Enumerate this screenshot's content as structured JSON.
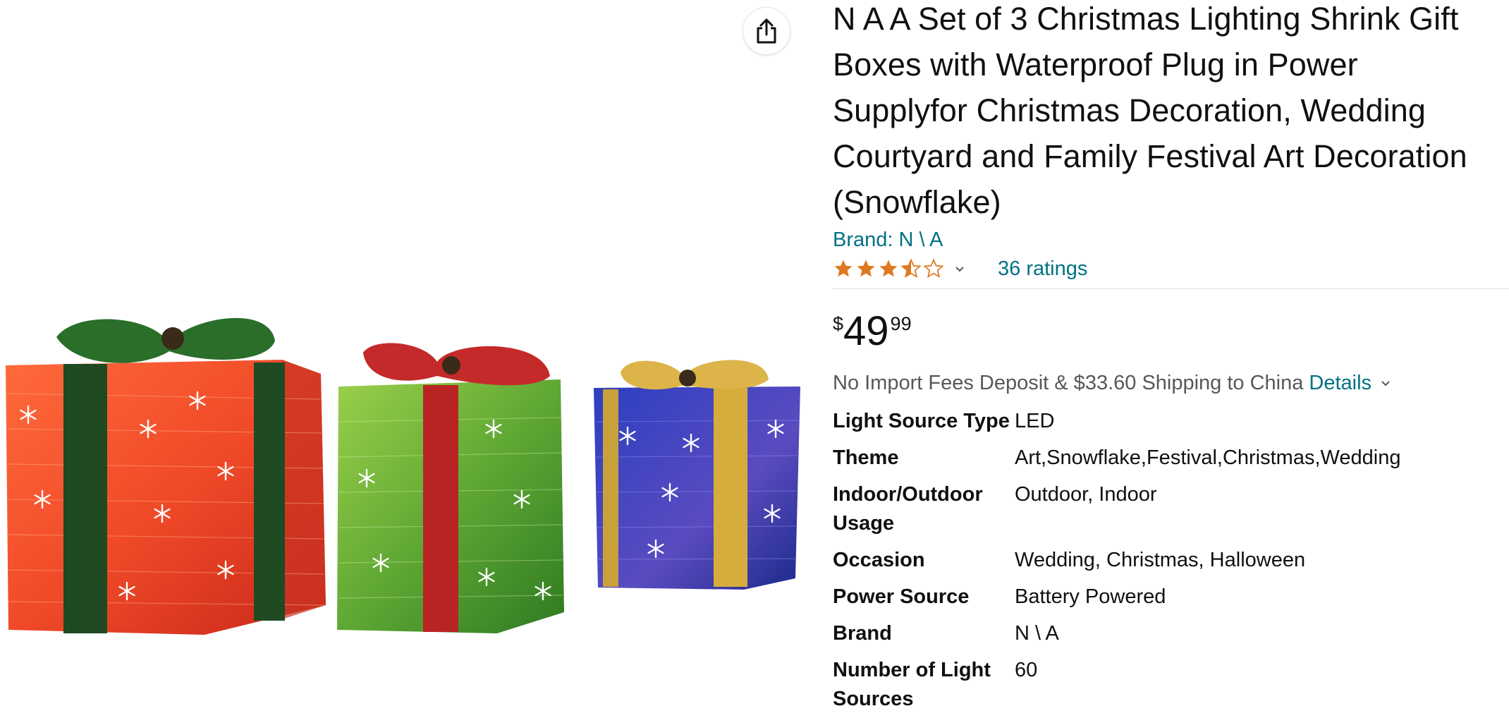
{
  "product": {
    "title": "N A A Set of 3 Christmas Lighting Shrink Gift Boxes with Waterproof Plug in Power Supplyfor Christmas Decoration, Wedding Courtyard and Family Festival Art Decoration (Snowflake)",
    "brand_link": "Brand: N \\ A",
    "rating": {
      "stars": 3.5,
      "out_of": 5,
      "ratings_label": "36 ratings"
    },
    "price": {
      "symbol": "$",
      "whole": "49",
      "fraction": "99"
    },
    "shipping": {
      "text": "No Import Fees Deposit & $33.60 Shipping to China",
      "details_label": "Details"
    },
    "specs": [
      {
        "label": "Light Source Type",
        "value": "LED"
      },
      {
        "label": "Theme",
        "value": "Art,Snowflake,Festival,Christmas,Wedding"
      },
      {
        "label": "Indoor/Outdoor Usage",
        "value": "Outdoor, Indoor"
      },
      {
        "label": "Occasion",
        "value": "Wedding, Christmas, Halloween"
      },
      {
        "label": "Power Source",
        "value": "Battery Powered"
      },
      {
        "label": "Brand",
        "value": "N \\ A"
      },
      {
        "label": "Number of Light Sources",
        "value": "60"
      }
    ]
  },
  "colors": {
    "link": "#007185",
    "star": "#de7921",
    "text": "#0f1111",
    "secondary_text": "#565959",
    "red_box": "#e8442a",
    "green_box": "#4d9a2d",
    "blue_box": "#2a3aa8"
  },
  "icons": {
    "share": "share-icon",
    "star": "star-icon",
    "caret": "chevron-down-icon"
  }
}
